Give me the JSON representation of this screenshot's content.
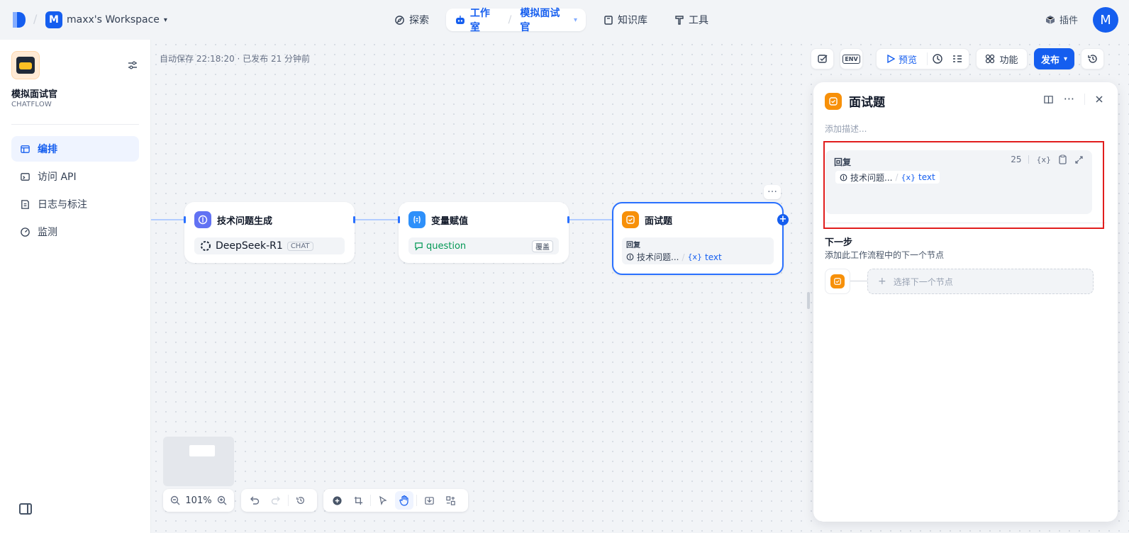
{
  "topbar": {
    "workspace_initial": "M",
    "workspace_name": "maxx's Workspace",
    "nav": [
      {
        "label": "探索"
      },
      {
        "label": "工作室"
      },
      {
        "label": "知识库"
      },
      {
        "label": "工具"
      }
    ],
    "breadcrumb_app": "模拟面试官",
    "plugin_label": "插件",
    "avatar_initial": "M"
  },
  "sidebar": {
    "app_name": "模拟面试官",
    "app_type": "CHATFLOW",
    "items": [
      {
        "label": "编排",
        "active": true
      },
      {
        "label": "访问 API"
      },
      {
        "label": "日志与标注"
      },
      {
        "label": "监测"
      }
    ]
  },
  "canvas": {
    "autosave": "自动保存 22:18:20 · 已发布 21 分钟前",
    "toolbar": {
      "env_label": "ENV",
      "preview_label": "预览",
      "features_label": "功能",
      "publish_label": "发布"
    },
    "nodes": [
      {
        "title": "技术问题生成",
        "model": "DeepSeek-R1",
        "mode": "CHAT"
      },
      {
        "title": "变量赋值",
        "variable": "question",
        "op": "覆盖"
      },
      {
        "title": "面试题",
        "field_label": "回复",
        "ref_node": "技术问题...",
        "ref_var": "text"
      }
    ],
    "zoom": "101%"
  },
  "panel": {
    "title": "面试题",
    "description_placeholder": "添加描述...",
    "reply_label": "回复",
    "reply_count": "25",
    "reply_var_node": "技术问题...",
    "reply_var_name": "text",
    "next_title": "下一步",
    "next_desc": "添加此工作流程中的下一个节点",
    "next_select": "选择下一个节点"
  },
  "colors": {
    "accent": "#155eef",
    "highlight": "#e11d1d",
    "answer_node": "#f79009"
  }
}
